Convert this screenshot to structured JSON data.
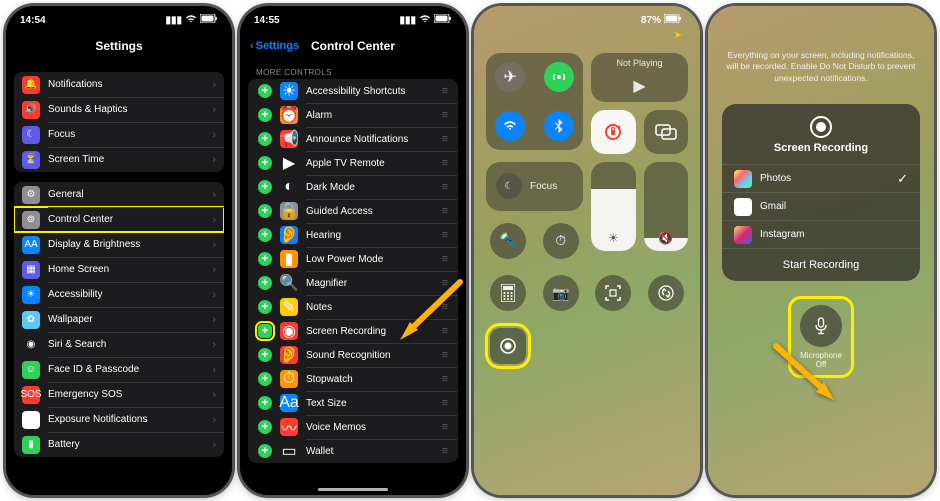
{
  "p1": {
    "time": "14:54",
    "title": "Settings",
    "rows1": [
      {
        "icon": "🔔",
        "bg": "#ff3b30",
        "label": "Notifications"
      },
      {
        "icon": "🔊",
        "bg": "#ff3b30",
        "label": "Sounds & Haptics"
      },
      {
        "icon": "☾",
        "bg": "#5e5ce6",
        "label": "Focus"
      },
      {
        "icon": "⏳",
        "bg": "#5e5ce6",
        "label": "Screen Time"
      }
    ],
    "rows2": [
      {
        "icon": "⚙",
        "bg": "#8e8e93",
        "label": "General"
      },
      {
        "icon": "⊚",
        "bg": "#8e8e93",
        "label": "Control Center",
        "hl": true
      },
      {
        "icon": "AA",
        "bg": "#0a84ff",
        "label": "Display & Brightness"
      },
      {
        "icon": "▦",
        "bg": "#5e5ce6",
        "label": "Home Screen"
      },
      {
        "icon": "☀",
        "bg": "#0a84ff",
        "label": "Accessibility"
      },
      {
        "icon": "✿",
        "bg": "#5ac8fa",
        "label": "Wallpaper"
      },
      {
        "icon": "◉",
        "bg": "#1c1c1e",
        "label": "Siri & Search"
      },
      {
        "icon": "☺",
        "bg": "#30d158",
        "label": "Face ID & Passcode"
      },
      {
        "icon": "SOS",
        "bg": "#ff3b30",
        "label": "Emergency SOS"
      },
      {
        "icon": "✳",
        "bg": "#fff",
        "label": "Exposure Notifications"
      },
      {
        "icon": "▮",
        "bg": "#30d158",
        "label": "Battery"
      }
    ]
  },
  "p2": {
    "time": "14:55",
    "back": "Settings",
    "title": "Control Center",
    "header": "MORE CONTROLS",
    "rows": [
      {
        "icon": "☀",
        "bg": "#0a84ff",
        "label": "Accessibility Shortcuts"
      },
      {
        "icon": "⏰",
        "bg": "#ff9500",
        "label": "Alarm"
      },
      {
        "icon": "📢",
        "bg": "#ff3b30",
        "label": "Announce Notifications"
      },
      {
        "icon": "▶",
        "bg": "#1c1c1e",
        "label": "Apple TV Remote"
      },
      {
        "icon": "◐",
        "bg": "#1c1c1e",
        "label": "Dark Mode"
      },
      {
        "icon": "🔒",
        "bg": "#8e8e93",
        "label": "Guided Access"
      },
      {
        "icon": "👂",
        "bg": "#0a84ff",
        "label": "Hearing"
      },
      {
        "icon": "▮",
        "bg": "#ff9500",
        "label": "Low Power Mode"
      },
      {
        "icon": "🔍",
        "bg": "#1c1c1e",
        "label": "Magnifier"
      },
      {
        "icon": "✎",
        "bg": "#ffcc00",
        "label": "Notes"
      },
      {
        "icon": "◉",
        "bg": "#ff3b30",
        "label": "Screen Recording",
        "hl": true
      },
      {
        "icon": "👂",
        "bg": "#ff3b30",
        "label": "Sound Recognition"
      },
      {
        "icon": "⏱",
        "bg": "#ff9500",
        "label": "Stopwatch"
      },
      {
        "icon": "Aa",
        "bg": "#0a84ff",
        "label": "Text Size"
      },
      {
        "icon": "〰",
        "bg": "#ff3b30",
        "label": "Voice Memos"
      },
      {
        "icon": "▭",
        "bg": "#1c1c1e",
        "label": "Wallet"
      }
    ]
  },
  "p3": {
    "battery": "87%",
    "np": "Not Playing",
    "focus": "Focus"
  },
  "p4": {
    "tip": "Everything on your screen, including notifications, will be recorded. Enable Do Not Disturb to prevent unexpected notifications.",
    "sheet_title": "Screen Recording",
    "apps": [
      {
        "name": "Photos",
        "bg": "linear-gradient(135deg,#ff6,#f66,#6cf,#6f6)",
        "checked": true
      },
      {
        "name": "Gmail",
        "bg": "#fff"
      },
      {
        "name": "Instagram",
        "bg": "linear-gradient(135deg,#feda75,#d62976,#4f5bd5)"
      }
    ],
    "start": "Start Recording",
    "mic_label": "Microphone",
    "mic_state": "Off"
  }
}
